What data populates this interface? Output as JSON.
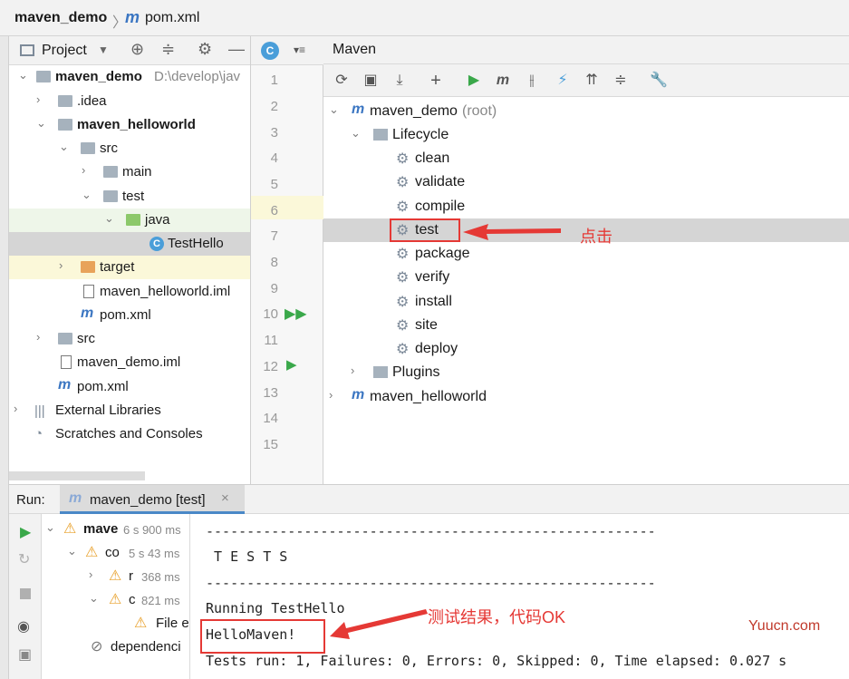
{
  "breadcrumb": {
    "project": "maven_demo",
    "separator": "〉",
    "file": "pom.xml"
  },
  "project_panel": {
    "title": "Project",
    "tree": [
      {
        "label": "maven_demo",
        "path": "D:\\develop\\jav"
      },
      {
        "label": ".idea"
      },
      {
        "label": "maven_helloworld"
      },
      {
        "label": "src"
      },
      {
        "label": "main"
      },
      {
        "label": "test"
      },
      {
        "label": "java"
      },
      {
        "label": "TestHello"
      },
      {
        "label": "target"
      },
      {
        "label": "maven_helloworld.iml"
      },
      {
        "label": "pom.xml"
      },
      {
        "label": "src"
      },
      {
        "label": "maven_demo.iml"
      },
      {
        "label": "pom.xml"
      },
      {
        "label": "External Libraries"
      },
      {
        "label": "Scratches and Consoles"
      }
    ]
  },
  "editor": {
    "line_numbers": [
      "1",
      "2",
      "3",
      "4",
      "5",
      "6",
      "7",
      "8",
      "9",
      "10",
      "11",
      "12",
      "13",
      "14",
      "15"
    ]
  },
  "maven_panel": {
    "title": "Maven",
    "root": "maven_demo",
    "root_suffix": "(root)",
    "lifecycle_label": "Lifecycle",
    "lifecycle": [
      "clean",
      "validate",
      "compile",
      "test",
      "package",
      "verify",
      "install",
      "site",
      "deploy"
    ],
    "plugins_label": "Plugins",
    "module": "maven_helloworld",
    "selected": "test",
    "annotation": "点击"
  },
  "run_panel": {
    "label": "Run:",
    "tab_title": "maven_demo [test]",
    "tree": [
      {
        "label": "mave",
        "time": "6 s 900 ms"
      },
      {
        "label": "co",
        "time": "5 s 43 ms"
      },
      {
        "label": "r",
        "time": "368 ms"
      },
      {
        "label": "c",
        "time": "821 ms"
      },
      {
        "label": "File e"
      },
      {
        "label": "dependenci"
      }
    ],
    "console": [
      "-------------------------------------------------------",
      " T E S T S",
      "-------------------------------------------------------",
      "Running TestHello",
      "HelloMaven!",
      "Tests run: 1, Failures: 0, Errors: 0, Skipped: 0, Time elapsed: 0.027 s"
    ],
    "annotation": "测试结果，代码OK"
  },
  "watermark": "Yuucn.com",
  "colors": {
    "accent_red": "#e53935",
    "selected_bg": "#d5d5d5",
    "maven_blue": "#3b76c2"
  }
}
